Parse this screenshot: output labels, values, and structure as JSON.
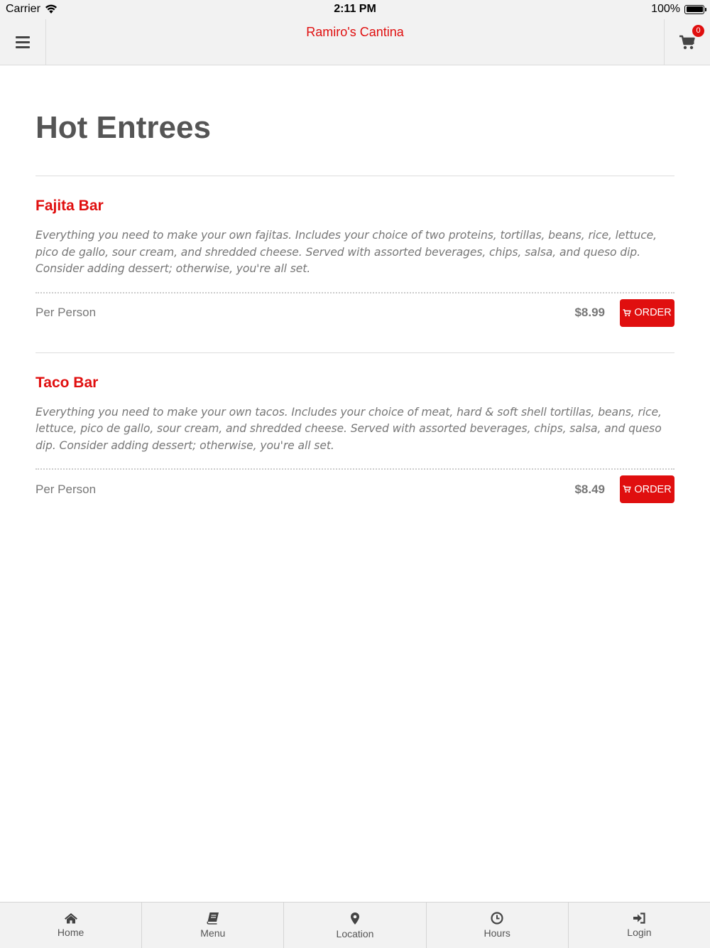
{
  "status_bar": {
    "carrier": "Carrier",
    "time": "2:11 PM",
    "battery": "100%"
  },
  "nav": {
    "title": "Ramiro's Cantina",
    "cart_count": "0"
  },
  "page": {
    "title": "Hot Entrees"
  },
  "items": [
    {
      "name": "Fajita Bar",
      "description": "Everything you need to make your own fajitas. Includes your choice of two proteins, tortillas, beans, rice, lettuce, pico de gallo, sour cream, and shredded cheese. Served with assorted beverages, chips, salsa, and queso dip. Consider adding dessert; otherwise, you're all set.",
      "unit": "Per Person",
      "price": "$8.99",
      "order_label": "ORDER"
    },
    {
      "name": "Taco Bar",
      "description": "Everything you need to make your own tacos. Includes your choice of meat, hard & soft shell tortillas, beans, rice, lettuce, pico de gallo, sour cream, and shredded cheese. Served with assorted beverages, chips, salsa, and queso dip. Consider adding dessert; otherwise, you're all set.",
      "unit": "Per Person",
      "price": "$8.49",
      "order_label": "ORDER"
    }
  ],
  "tabs": [
    {
      "label": "Home",
      "icon": "home-icon"
    },
    {
      "label": "Menu",
      "icon": "book-icon"
    },
    {
      "label": "Location",
      "icon": "map-pin-icon"
    },
    {
      "label": "Hours",
      "icon": "clock-icon"
    },
    {
      "label": "Login",
      "icon": "sign-in-icon"
    }
  ],
  "colors": {
    "accent": "#e00f0f",
    "bar_bg": "#f2f2f2",
    "text": "#555555"
  }
}
